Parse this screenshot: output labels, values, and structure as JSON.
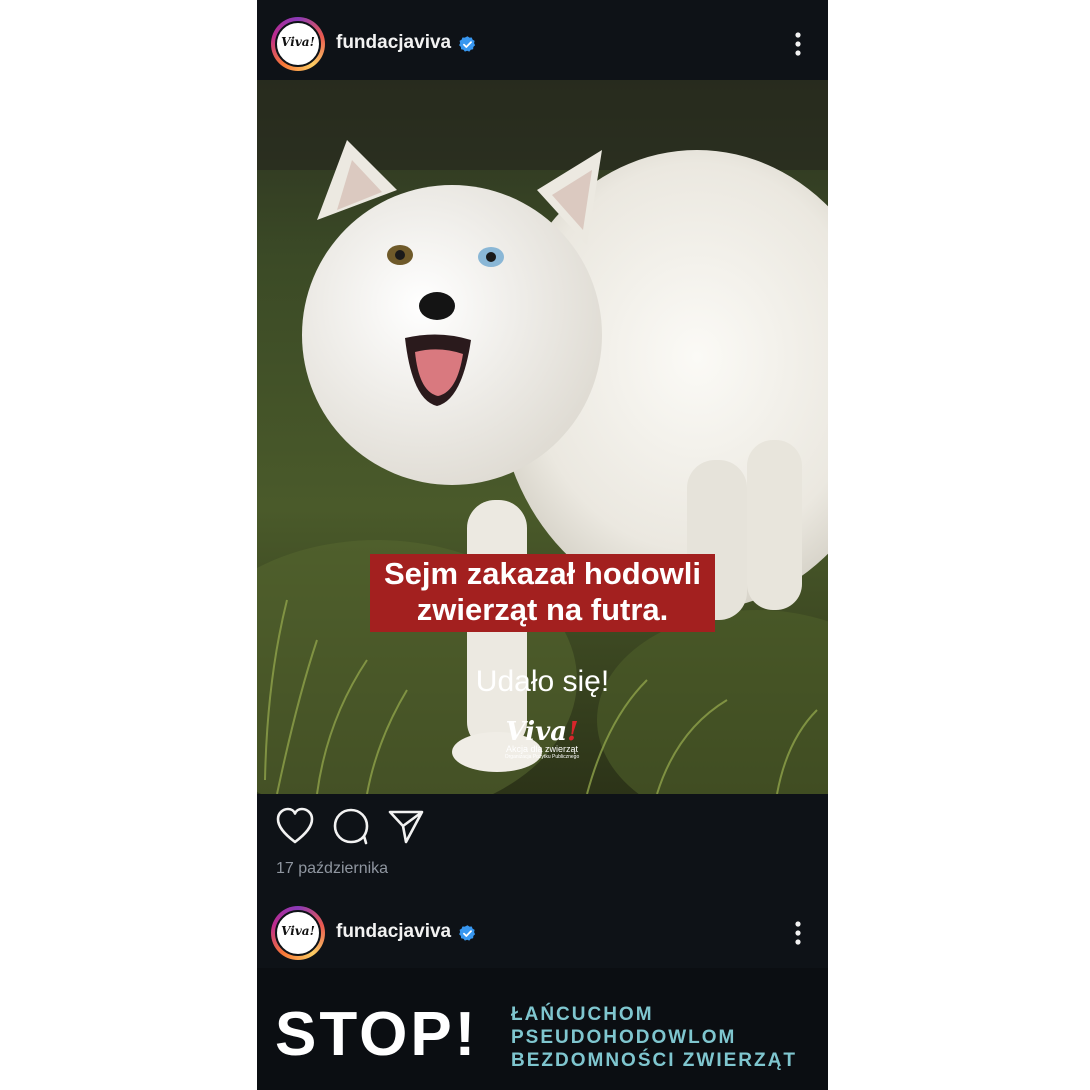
{
  "post1": {
    "username": "fundacjaviva",
    "avatar_logo": "Viva!",
    "caption_line1": "Sejm zakazał hodowli",
    "caption_line2": "zwierząt na futra.",
    "subcaption": "Udało się!",
    "logo_word": "Viva",
    "logo_bang": "!",
    "logo_sub": "Akcja dla zwierząt",
    "logo_sub2": "Organizacja Pożytku Publicznego",
    "date": "17 października"
  },
  "post2": {
    "username": "fundacjaviva",
    "avatar_logo": "Viva!",
    "stop_word": "STOP!",
    "stop_line1": "ŁAŃCUCHOM",
    "stop_line2": "PSEUDOHODOWLOM",
    "stop_line3": "BEZDOMNOŚCI ZWIERZĄT"
  },
  "colors": {
    "background": "#0e1217",
    "caption_red": "#a3201f",
    "verified_blue": "#3897f0",
    "stop_teal": "#7fc6cf"
  },
  "icons": [
    "verified-badge-icon",
    "more-options-icon",
    "heart-icon",
    "comment-icon",
    "share-icon"
  ]
}
